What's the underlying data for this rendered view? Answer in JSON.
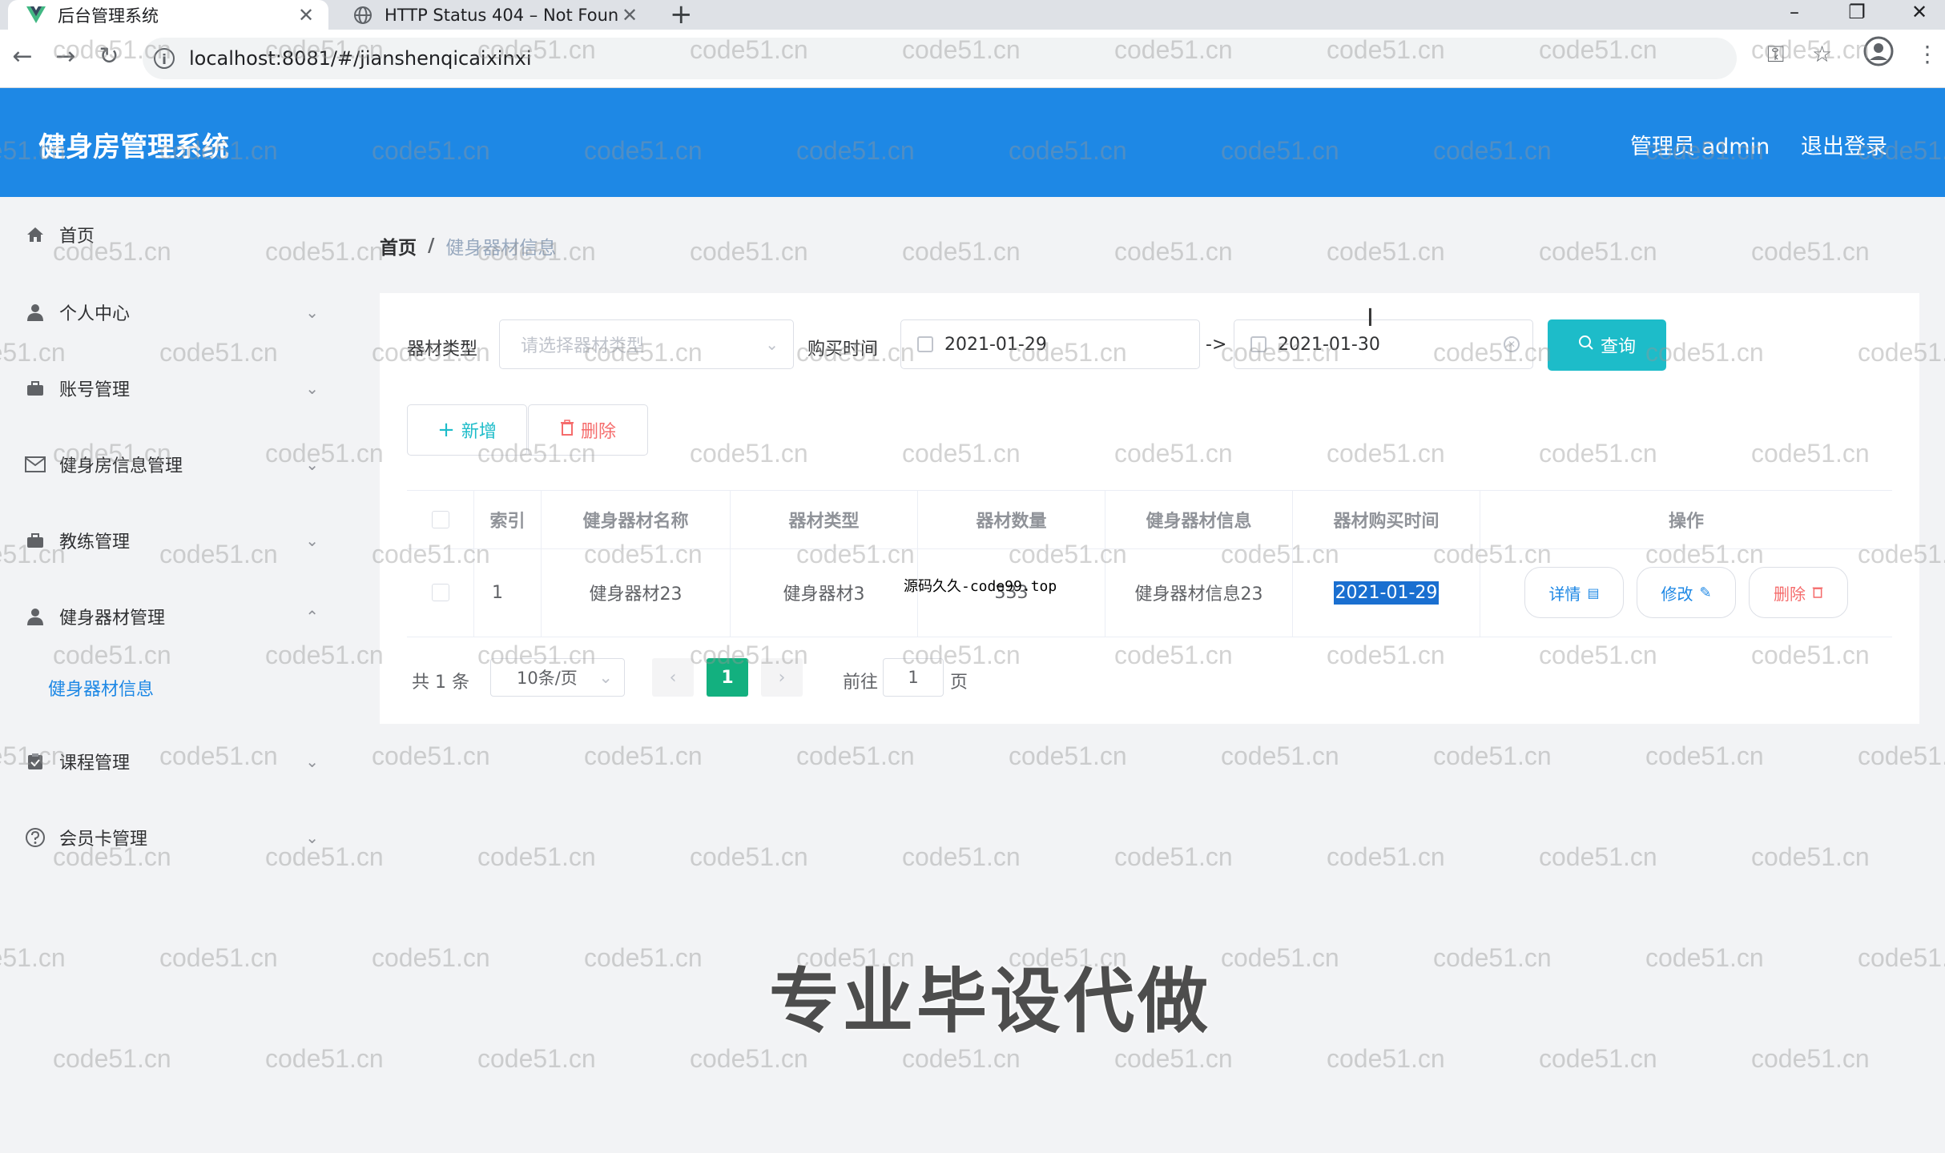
{
  "browser": {
    "tabs": [
      {
        "title": "后台管理系统",
        "icon": "vue-logo-icon",
        "active": true
      },
      {
        "title": "HTTP Status 404 – Not Found",
        "icon": "globe-icon",
        "active": false
      }
    ],
    "new_tab": "+",
    "url": "localhost:8081/#/jianshenqicaixinxi",
    "window_controls": {
      "minimize": "–",
      "maximize": "❐",
      "close": "✕"
    }
  },
  "header": {
    "title": "健身房管理系统",
    "user": "管理员 admin",
    "logout": "退出登录",
    "color": "#1e88e5"
  },
  "sidebar": {
    "items": [
      {
        "label": "首页",
        "icon": "home-icon"
      },
      {
        "label": "个人中心",
        "icon": "user-icon"
      },
      {
        "label": "账号管理",
        "icon": "briefcase-icon"
      },
      {
        "label": "健身房信息管理",
        "icon": "mail-icon"
      },
      {
        "label": "教练管理",
        "icon": "briefcase-icon"
      },
      {
        "label": "健身器材管理",
        "icon": "user-icon"
      },
      {
        "label": "课程管理",
        "icon": "clipboard-icon"
      },
      {
        "label": "会员卡管理",
        "icon": "help-circle-icon"
      }
    ],
    "sub_active": "健身器材信息"
  },
  "breadcrumb": {
    "home": "首页",
    "separator": "/",
    "current": "健身器材信息"
  },
  "filters": {
    "type_label": "器材类型",
    "type_placeholder": "请选择器材类型",
    "date_label": "购买时间",
    "date_start": "2021-01-29",
    "date_sep": "->",
    "date_end": "2021-01-30",
    "query_button": "查询"
  },
  "actions": {
    "add": "新增",
    "delete": "删除"
  },
  "table": {
    "headers": [
      "索引",
      "健身器材名称",
      "器材类型",
      "器材数量",
      "健身器材信息",
      "器材购买时间",
      "操作"
    ],
    "rows": [
      {
        "index": "1",
        "name": "健身器材23",
        "type": "健身器材3",
        "count": "333",
        "info": "健身器材信息23",
        "date": "2021-01-29"
      }
    ],
    "ops": {
      "detail": "详情",
      "edit": "修改",
      "remove": "删除"
    }
  },
  "pagination": {
    "total": "共 1 条",
    "page_size": "10条/页",
    "current_page": "1",
    "goto_prefix": "前往",
    "goto_value": "1",
    "goto_suffix": "页"
  },
  "overlay": {
    "watermark": "code51.cn",
    "promo": "专业毕设代做",
    "source_tag": "源码久久-code99.top"
  }
}
